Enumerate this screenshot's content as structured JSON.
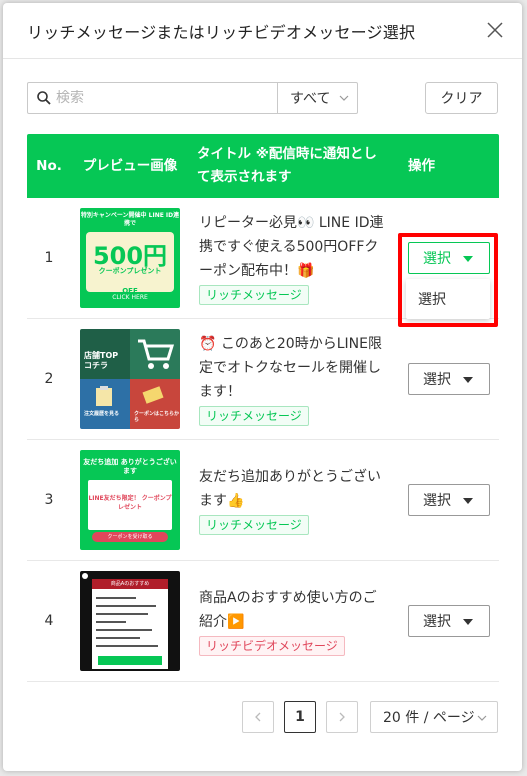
{
  "modal": {
    "title": "リッチメッセージまたはリッチビデオメッセージ選択"
  },
  "toolbar": {
    "search_placeholder": "検索",
    "filter_value": "すべて",
    "clear_label": "クリア"
  },
  "table": {
    "headers": {
      "no": "No.",
      "preview": "プレビュー画像",
      "title": "タイトル ※配信時に通知として表示されます",
      "operation": "操作"
    },
    "rows": [
      {
        "no": "1",
        "title": "リピーター必見👀 LINE ID連携ですぐ使える500円OFFクーポン配布中！🎁",
        "tag": "リッチメッセージ",
        "tag_color": "#06c755",
        "action_label": "選択",
        "preview": {
          "header": "特別キャンペーン開催中 LINE ID連携で",
          "amount": "500円",
          "amount_suffix": "OFF",
          "subtitle": "クーポンプレゼント",
          "cta": "CLICK HERE"
        }
      },
      {
        "no": "2",
        "title": "⏰ このあと20時からLINE限定でオトクなセールを開催します！",
        "tag": "リッチメッセージ",
        "tag_color": "#06c755",
        "action_label": "選択",
        "preview": {
          "header": "店舗TOP",
          "header2": "コチラ",
          "small": "注文履歴を見る",
          "small2": "クーポンはこちらから"
        }
      },
      {
        "no": "3",
        "title": "友だち追加ありがとうございます👍",
        "tag": "リッチメッセージ",
        "tag_color": "#06c755",
        "action_label": "選択",
        "preview": {
          "header": "友だち追加 ありがとうございます",
          "card_text": "LINE友だち限定！ クーポンプレゼント",
          "cta": "クーポンを受け取る"
        }
      },
      {
        "no": "4",
        "title": "商品Aのおすすめ使い方のご紹介▶️",
        "tag": "リッチビデオメッセージ",
        "tag_color": "#e0475b",
        "action_label": "選択",
        "preview": {
          "header": "商品Aのおすすめ"
        }
      }
    ]
  },
  "dropdown": {
    "option": "選択"
  },
  "pagination": {
    "current_page": "1",
    "page_size": "20 件 / ページ"
  },
  "colors": {
    "accent": "#06c755",
    "highlight": "#ff0000",
    "video_tag": "#e0475b"
  }
}
